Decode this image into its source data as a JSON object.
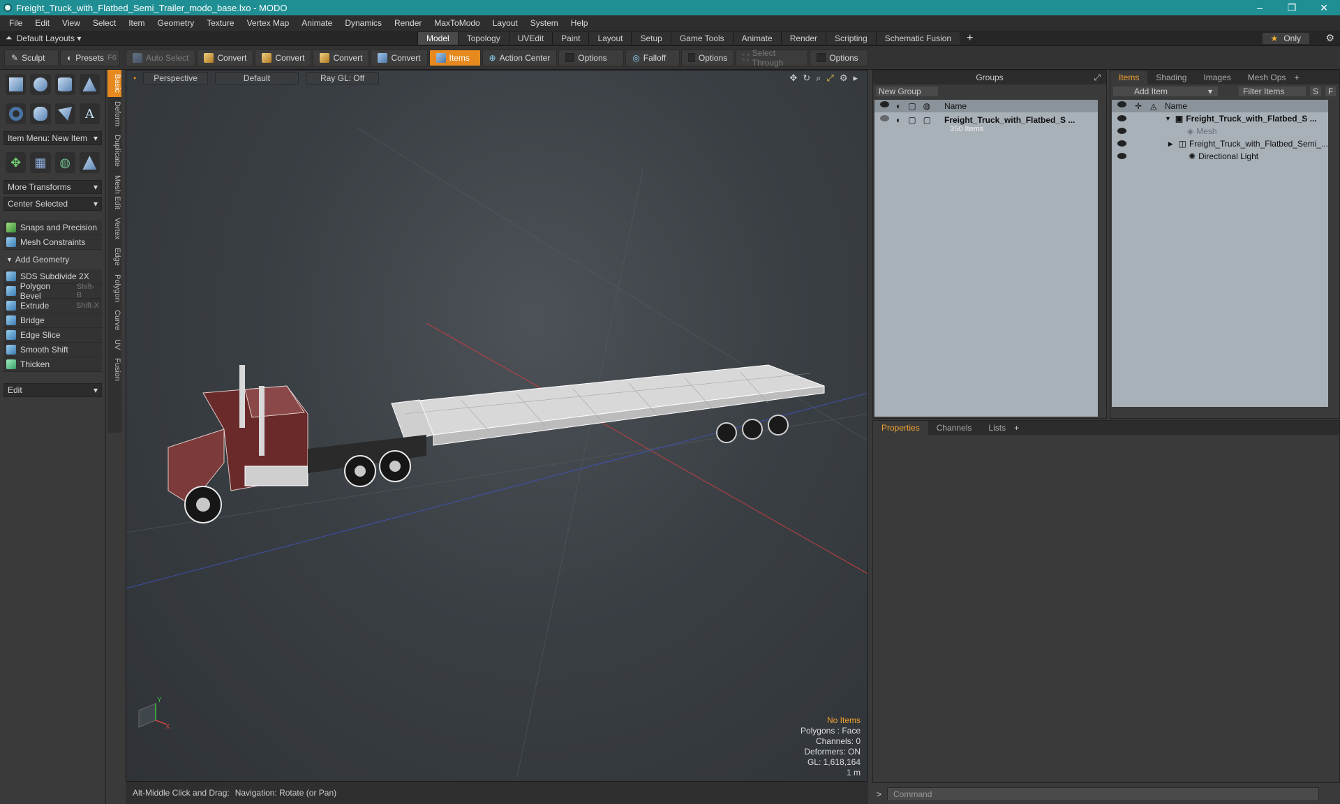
{
  "window": {
    "title": "Freight_Truck_with_Flatbed_Semi_Trailer_modo_base.lxo - MODO",
    "min": "–",
    "max": "❐",
    "close": "✕"
  },
  "menu": [
    "File",
    "Edit",
    "View",
    "Select",
    "Item",
    "Geometry",
    "Texture",
    "Vertex Map",
    "Animate",
    "Dynamics",
    "Render",
    "MaxToModo",
    "Layout",
    "System",
    "Help"
  ],
  "layouts": {
    "label": "Default Layouts",
    "tabs": [
      "Model",
      "Topology",
      "UVEdit",
      "Paint",
      "Layout",
      "Setup",
      "Game Tools",
      "Animate",
      "Render",
      "Scripting",
      "Schematic Fusion"
    ],
    "active": "Model",
    "plus": "+",
    "only": "Only",
    "star": "★",
    "gear": "⚙"
  },
  "toolbar": {
    "sculpt": "Sculpt",
    "presets": "Presets",
    "presets_key": "F6",
    "auto_select": "Auto Select",
    "convert": "Convert",
    "items": "Items",
    "action_center": "Action Center",
    "options": "Options",
    "falloff": "Falloff",
    "select_through": "Select Through"
  },
  "left": {
    "item_menu": "Item Menu: New Item",
    "more_transforms": "More Transforms",
    "center_selected": "Center Selected",
    "snaps": "Snaps and Precision",
    "mesh_constraints": "Mesh Constraints",
    "add_geometry": "Add Geometry",
    "tools": [
      {
        "label": "SDS Subdivide 2X",
        "key": ""
      },
      {
        "label": "Polygon Bevel",
        "key": "Shift-B"
      },
      {
        "label": "Extrude",
        "key": "Shift-X"
      },
      {
        "label": "Bridge",
        "key": ""
      },
      {
        "label": "Edge Slice",
        "key": ""
      },
      {
        "label": "Smooth Shift",
        "key": ""
      },
      {
        "label": "Thicken",
        "key": ""
      }
    ],
    "edit": "Edit",
    "vtabs": [
      "Basic",
      "Deform",
      "Duplicate",
      "Mesh Edit",
      "Vertex",
      "Edge",
      "Polygon",
      "Curve",
      "UV",
      "Fusion"
    ]
  },
  "viewport": {
    "perspective": "Perspective",
    "default": "Default",
    "raygl": "Ray GL: Off",
    "info": {
      "no_items": "No Items",
      "polygons": "Polygons : Face",
      "channels": "Channels: 0",
      "deformers": "Deformers: ON",
      "gl": "GL: 1,618,164",
      "scale": "1 m"
    }
  },
  "status": {
    "hint": "Alt-Middle Click and Drag:",
    "nav": "Navigation: Rotate (or Pan)"
  },
  "groups": {
    "title": "Groups",
    "new_group": "New Group",
    "name_col": "Name",
    "item_name": "Freight_Truck_with_Flatbed_S ...",
    "item_count": "350 Items"
  },
  "items": {
    "tabs": [
      "Items",
      "Shading",
      "Images",
      "Mesh Ops"
    ],
    "add_item": "Add Item",
    "filter": "Filter Items",
    "s": "S",
    "f": "F",
    "name_col": "Name",
    "rows": [
      "Freight_Truck_with_Flatbed_S ...",
      "Mesh",
      "Freight_Truck_with_Flatbed_Semi_...",
      "Directional Light"
    ]
  },
  "props": {
    "tabs": [
      "Properties",
      "Channels",
      "Lists"
    ],
    "plus": "+"
  },
  "command": {
    "placeholder": "Command",
    "prompt": ">"
  }
}
